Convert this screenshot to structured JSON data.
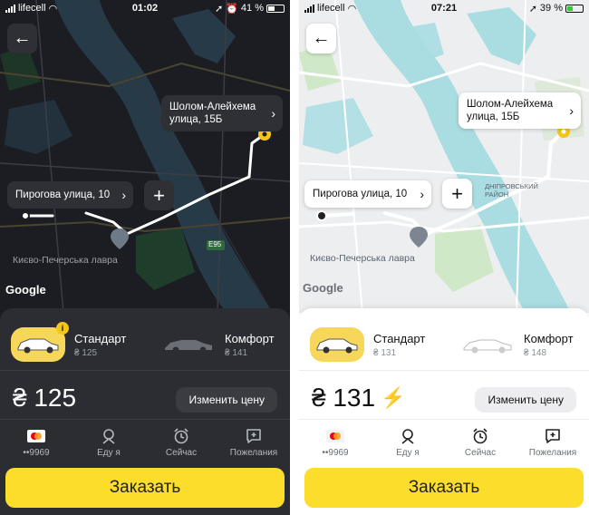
{
  "screens": [
    {
      "theme": "dark",
      "status": {
        "carrier": "lifecell",
        "time": "01:02",
        "battery": "41 %"
      },
      "map": {
        "from_address": "Пирогова улица, 10",
        "to_address_line1": "Шолом-Алейхема",
        "to_address_line2": "улица, 15Б",
        "labels": {
          "lavra": "Києво-Печерська лавра",
          "road": "E95"
        },
        "google": "Google"
      },
      "tariffs": [
        {
          "name": "Стандарт",
          "price": "₴ 125",
          "active": true
        },
        {
          "name": "Комфорт",
          "price": "₴ 141",
          "active": false
        }
      ],
      "price": {
        "value": "₴ 125",
        "surge": ""
      },
      "change_price_label": "Изменить цену",
      "actions": [
        {
          "label": "••9969",
          "icon": "mastercard-icon"
        },
        {
          "label": "Еду я",
          "icon": "person-icon"
        },
        {
          "label": "Сейчас",
          "icon": "alarm-clock-icon"
        },
        {
          "label": "Пожелания",
          "icon": "comment-plus-icon"
        }
      ],
      "order_label": "Заказать"
    },
    {
      "theme": "light",
      "status": {
        "carrier": "lifecell",
        "time": "07:21",
        "battery": "39 %"
      },
      "map": {
        "from_address": "Пирогова улица, 10",
        "to_address_line1": "Шолом-Алейхема",
        "to_address_line2": "улица, 15Б",
        "labels": {
          "lavra": "Києво-Печерська лавра",
          "district": "ДНІПРОВСЬКИЙ РАЙОН"
        },
        "google": "Google"
      },
      "tariffs": [
        {
          "name": "Стандарт",
          "price": "₴ 131",
          "active": true
        },
        {
          "name": "Комфорт",
          "price": "₴ 148",
          "active": false
        }
      ],
      "price": {
        "value": "₴ 131",
        "surge": "⚡"
      },
      "change_price_label": "Изменить цену",
      "actions": [
        {
          "label": "••9969",
          "icon": "mastercard-icon"
        },
        {
          "label": "Еду я",
          "icon": "person-icon"
        },
        {
          "label": "Сейчас",
          "icon": "alarm-clock-icon"
        },
        {
          "label": "Пожелания",
          "icon": "comment-plus-icon"
        }
      ],
      "order_label": "Заказать"
    }
  ],
  "colors": {
    "accent_yellow": "#fcdd2b",
    "dark_bg": "#1e1f23",
    "dark_water": "#2a4a5e",
    "light_water": "#a9dde2",
    "park_green_dark": "#1f3d2b",
    "park_green_light": "#cfe8c8",
    "destination_pin": "#f5c518"
  }
}
